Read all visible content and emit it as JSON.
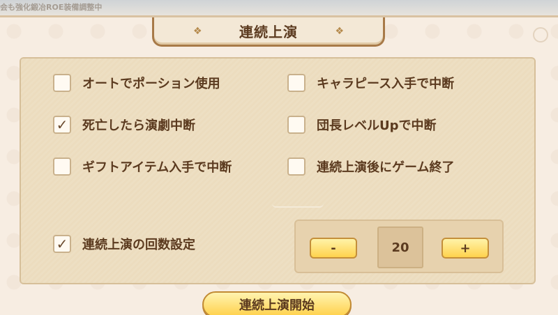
{
  "background_text": "会も強化鍛冶ROE装備調整中",
  "title": "連続上演",
  "options": [
    {
      "label": "オートでポーション使用",
      "checked": false
    },
    {
      "label": "キャラピース入手で中断",
      "checked": false
    },
    {
      "label": "死亡したら演劇中断",
      "checked": true
    },
    {
      "label": "団長レベルUpで中断",
      "checked": false
    },
    {
      "label": "ギフトアイテム入手で中断",
      "checked": false
    },
    {
      "label": "連続上演後にゲーム終了",
      "checked": false
    }
  ],
  "repeat_setting": {
    "label": "連続上演の回数設定",
    "checked": true
  },
  "counter": {
    "minus_label": "-",
    "value": "20",
    "plus_label": "+"
  },
  "start_button": "連続上演開始",
  "check_mark": "✓",
  "colors": {
    "panel": "#ecdcbe",
    "text": "#5b3a1f",
    "button": "#ffd24d"
  }
}
